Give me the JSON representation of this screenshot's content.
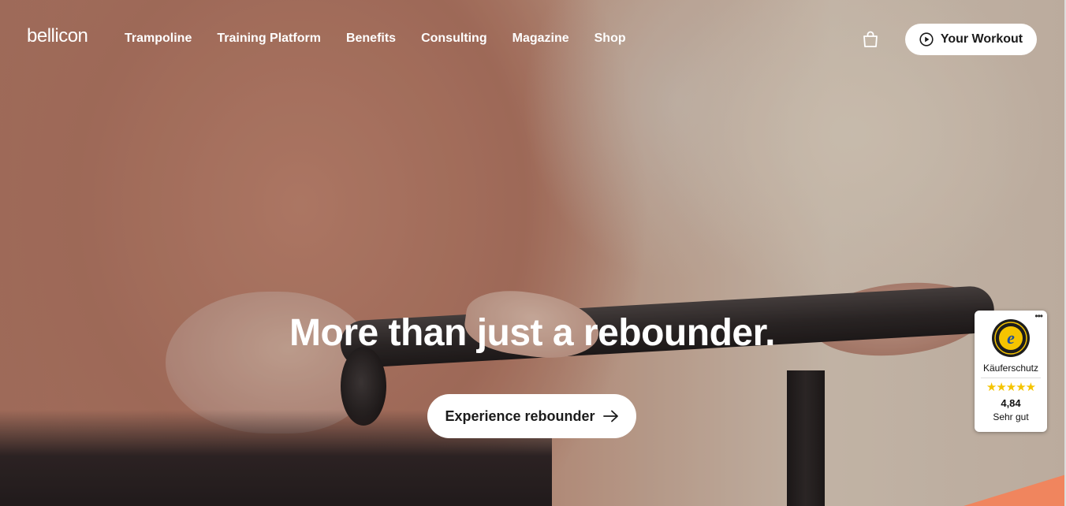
{
  "header": {
    "logo": "bellicon",
    "nav": [
      "Trampoline",
      "Training Platform",
      "Benefits",
      "Consulting",
      "Magazine",
      "Shop"
    ],
    "cart_icon": "shopping-bag-icon",
    "workout_button": "Your Workout",
    "workout_icon": "play-circle-icon"
  },
  "hero": {
    "headline": "More than just a rebounder.",
    "cta_label": "Experience rebounder",
    "cta_icon": "arrow-right-icon"
  },
  "trusted_shops": {
    "menu": "•••",
    "seal_icon": "trusted-shops-guarantee-seal",
    "seal_letter": "e",
    "label": "Käuferschutz",
    "stars": "★★★★★",
    "rating": "4,84",
    "grade": "Sehr gut"
  },
  "colors": {
    "accent": "#f0855e",
    "star": "#f5c400",
    "button_bg": "#ffffff",
    "button_text": "#1b1b1b"
  }
}
